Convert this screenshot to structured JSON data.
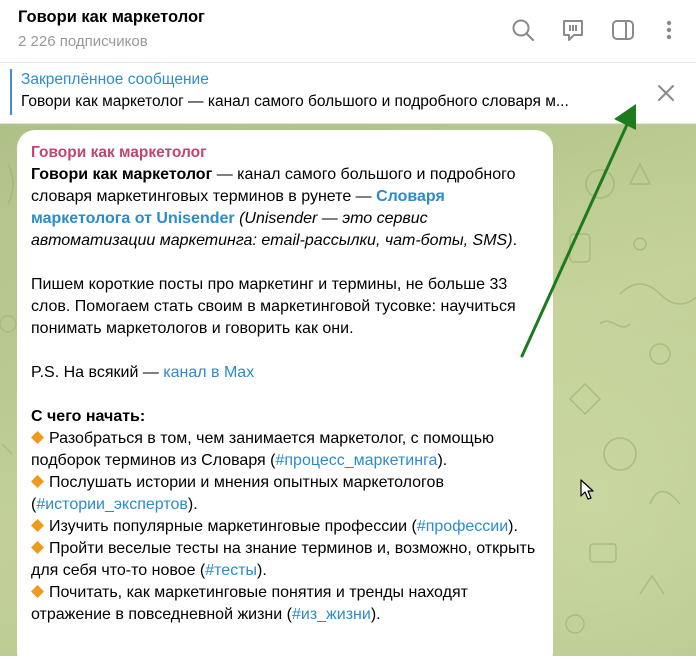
{
  "header": {
    "title": "Говори как маркетолог",
    "subscribers": "2 226 подписчиков"
  },
  "pinned": {
    "label": "Закреплённое сообщение",
    "text": "Говори как маркетолог — канал самого большого и подробного словаря м..."
  },
  "message": {
    "author": "Говори как маркетолог",
    "p1_bold": "Говори как маркетолог",
    "p1_a": " — канал самого большого и подробного словаря маркетинговых терминов в рунете — ",
    "p1_link": "Словаря маркетолога от Unisender",
    "p1_b": " ",
    "p1_italic": "(Unisender — это сервис автоматизации маркетинга: email-рассылки, чат-боты, SMS)",
    "p1_end": ".",
    "p2": "Пишем короткие посты про маркетинг и термины, не больше 33 слов. Помогаем стать своим в маркетинговой тусовке: научиться понимать маркетологов и говорить как они.",
    "ps_text": "P.S. На всякий — ",
    "ps_link": "канал в Max",
    "start_heading": "С чего начать:",
    "items": [
      {
        "text": "Разобраться в том, чем занимается маркетолог, с помощью подборок терминов из Словаря (",
        "tag": "#процесс_маркетинга",
        "end": ")."
      },
      {
        "text": "Послушать истории и мнения опытных маркетологов (",
        "tag": "#истории_экспертов",
        "end": ")."
      },
      {
        "text": "Изучить популярные маркетинговые профессии (",
        "tag": "#профессии",
        "end": ")."
      },
      {
        "text": "Пройти веселые тесты на знание терминов и, возможно, открыть для себя что-то новое (",
        "tag": "#тесты",
        "end": ")."
      },
      {
        "text": "Почитать, как маркетинговые понятия и тренды находят отражение в повседневной жизни (",
        "tag": "#из_жизни",
        "end": ")."
      }
    ]
  },
  "colors": {
    "accent": "#2b8ccc",
    "author": "#c2456f",
    "arrow": "#1e7a1e",
    "diamond": "#f09a1c"
  },
  "icons": [
    "search-icon",
    "comments-icon",
    "sidebar-toggle-icon",
    "more-icon",
    "close-icon",
    "diamond-icon",
    "cursor-icon",
    "annotation-arrow"
  ]
}
